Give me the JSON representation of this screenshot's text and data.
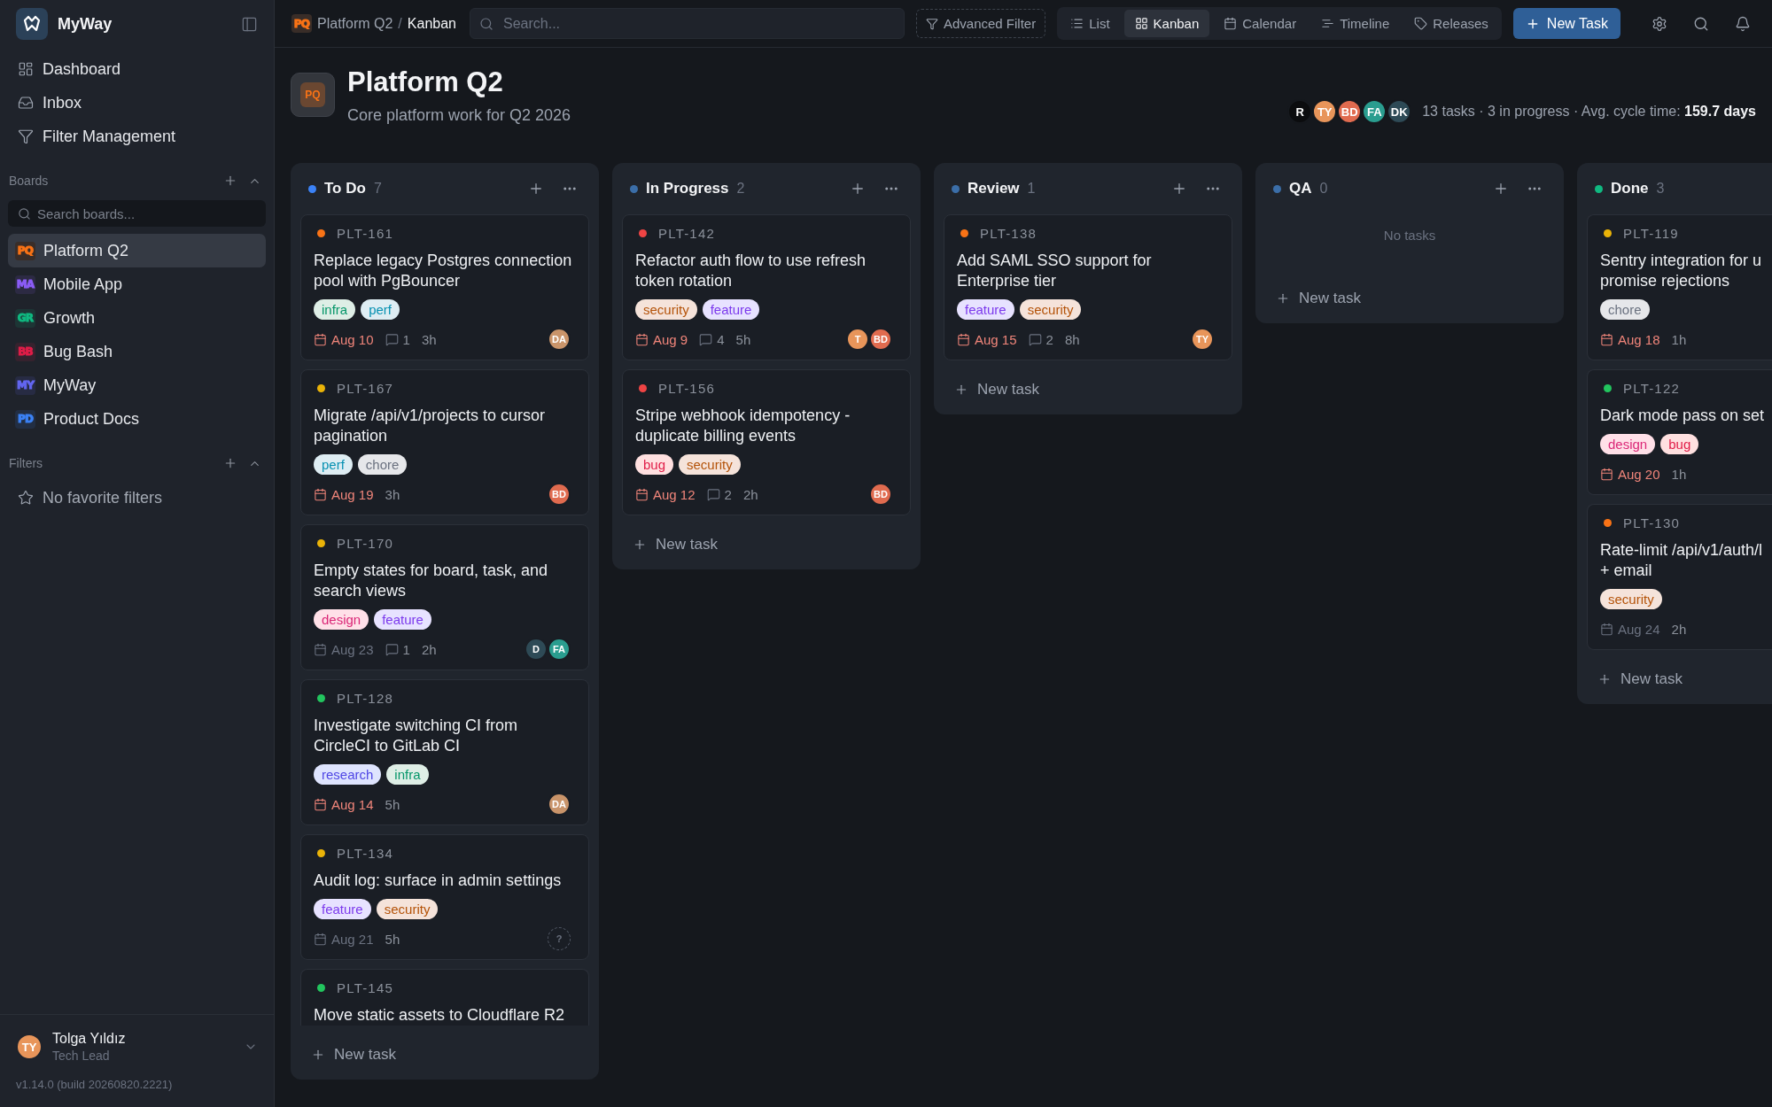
{
  "sidebar": {
    "app_name": "MyWay",
    "nav": [
      {
        "label": "Dashboard"
      },
      {
        "label": "Inbox"
      },
      {
        "label": "Filter Management"
      }
    ],
    "boards": {
      "title": "Boards",
      "expanded": true,
      "search_placeholder": "Search boards...",
      "items": [
        {
          "code": "PQ",
          "label": "Platform Q2",
          "color": "#f97316",
          "selected": true
        },
        {
          "code": "MA",
          "label": "Mobile App",
          "color": "#8b5cf6",
          "selected": false
        },
        {
          "code": "GR",
          "label": "Growth",
          "color": "#10b981",
          "selected": false
        },
        {
          "code": "BB",
          "label": "Bug Bash",
          "color": "#e11d48",
          "selected": false
        },
        {
          "code": "MY",
          "label": "MyWay",
          "color": "#6366f1",
          "selected": false
        },
        {
          "code": "PD",
          "label": "Product Docs",
          "color": "#3b82f6",
          "selected": false
        }
      ]
    },
    "filters": {
      "title": "Filters",
      "expanded": true,
      "empty": "No favorite filters"
    },
    "user": {
      "initials": "TY",
      "name": "Tolga Yıldız",
      "role": "Tech Lead"
    },
    "version": "v1.14.0 (build 20260820.2221)"
  },
  "topbar": {
    "breadcrumb": {
      "code": "PQ",
      "board": "Platform Q2",
      "separator": "/",
      "current": "Kanban"
    },
    "search_placeholder": "Search...",
    "advanced_filter": "Advanced Filter",
    "views": [
      {
        "label": "List",
        "selected": false
      },
      {
        "label": "Kanban",
        "selected": true
      },
      {
        "label": "Calendar",
        "selected": false
      },
      {
        "label": "Timeline",
        "selected": false
      },
      {
        "label": "Releases",
        "selected": false
      }
    ],
    "new_task": "New Task"
  },
  "board": {
    "code": "PQ",
    "title": "Platform Q2",
    "subtitle": "Core platform work for Q2 2026",
    "members": [
      {
        "initials": "R",
        "color": "#0b0c0e"
      },
      {
        "initials": "TY",
        "color": "#e8955a"
      },
      {
        "initials": "BD",
        "color": "#e06b4f"
      },
      {
        "initials": "FA",
        "color": "#2a9d8f"
      },
      {
        "initials": "DK",
        "color": "#2e4a56"
      }
    ],
    "stats": "13 tasks · 3 in progress · Avg. cycle time: **159.7 days**"
  },
  "columns": [
    {
      "title": "To Do",
      "count": "7",
      "color": "#3b82f6",
      "clipped": false,
      "add_label": "New task",
      "cards": [
        {
          "id": "PLT-161",
          "color": "#f97316",
          "title": "Replace legacy Postgres connection pool with PgBouncer",
          "tags": [
            {
              "label": "infra",
              "color": "#059669"
            },
            {
              "label": "perf",
              "color": "#0891b2"
            }
          ],
          "due": {
            "date": "Aug 10",
            "overdue": true
          },
          "comments": "1",
          "estimate": "3h",
          "assignees": [
            {
              "initials": "DA",
              "kind": "person",
              "color": "#c9946a"
            }
          ]
        },
        {
          "id": "PLT-167",
          "color": "#eab308",
          "title": "Migrate /api/v1/projects to cursor pagination",
          "tags": [
            {
              "label": "perf",
              "color": "#0891b2"
            },
            {
              "label": "chore",
              "color": "#6b7280"
            }
          ],
          "due": {
            "date": "Aug 19",
            "overdue": true
          },
          "estimate": "3h",
          "assignees": [
            {
              "initials": "BD",
              "kind": "person",
              "color": "#e06b4f"
            }
          ]
        },
        {
          "id": "PLT-170",
          "color": "#eab308",
          "title": "Empty states for board, task, and search views",
          "tags": [
            {
              "label": "design",
              "color": "#db2777"
            },
            {
              "label": "feature",
              "color": "#7c3aed"
            }
          ],
          "due": {
            "date": "Aug 23",
            "overdue": false
          },
          "comments": "1",
          "estimate": "2h",
          "assignees": [
            {
              "initials": "D",
              "kind": "person",
              "color": "#2e4a56"
            },
            {
              "initials": "FA",
              "kind": "person",
              "color": "#2a9d8f"
            }
          ]
        },
        {
          "id": "PLT-128",
          "color": "#22c55e",
          "title": "Investigate switching CI from CircleCI to GitLab CI",
          "tags": [
            {
              "label": "research",
              "color": "#4f46e5"
            },
            {
              "label": "infra",
              "color": "#059669"
            }
          ],
          "due": {
            "date": "Aug 14",
            "overdue": true
          },
          "estimate": "5h",
          "assignees": [
            {
              "initials": "DA",
              "kind": "person",
              "color": "#c9946a"
            }
          ]
        },
        {
          "id": "PLT-134",
          "color": "#eab308",
          "title": "Audit log: surface in admin settings",
          "tags": [
            {
              "label": "feature",
              "color": "#7c3aed"
            },
            {
              "label": "security",
              "color": "#b45309"
            }
          ],
          "due": {
            "date": "Aug 21",
            "overdue": false
          },
          "estimate": "5h",
          "assignees": [
            {
              "initials": "?",
              "kind": "unassigned"
            }
          ]
        },
        {
          "id": "PLT-145",
          "color": "#22c55e",
          "title": "Move static assets to Cloudflare R2"
        }
      ]
    },
    {
      "title": "In Progress",
      "count": "2",
      "color": "#3b6ea8",
      "clipped": false,
      "add_label": "New task",
      "cards": [
        {
          "id": "PLT-142",
          "color": "#ef4444",
          "title": "Refactor auth flow to use refresh token rotation",
          "tags": [
            {
              "label": "security",
              "color": "#b45309"
            },
            {
              "label": "feature",
              "color": "#7c3aed"
            }
          ],
          "due": {
            "date": "Aug 9",
            "overdue": true
          },
          "comments": "4",
          "estimate": "5h",
          "assignees": [
            {
              "initials": "T",
              "kind": "person",
              "color": "#e8955a"
            },
            {
              "initials": "BD",
              "kind": "person",
              "color": "#e06b4f"
            }
          ]
        },
        {
          "id": "PLT-156",
          "color": "#ef4444",
          "title": "Stripe webhook idempotency - duplicate billing events",
          "tags": [
            {
              "label": "bug",
              "color": "#e11d48"
            },
            {
              "label": "security",
              "color": "#b45309"
            }
          ],
          "due": {
            "date": "Aug 12",
            "overdue": true
          },
          "comments": "2",
          "estimate": "2h",
          "assignees": [
            {
              "initials": "BD",
              "kind": "person",
              "color": "#e06b4f"
            }
          ]
        }
      ]
    },
    {
      "title": "Review",
      "count": "1",
      "color": "#3b6ea8",
      "clipped": false,
      "add_label": "New task",
      "cards": [
        {
          "id": "PLT-138",
          "color": "#f97316",
          "title": "Add SAML SSO support for Enterprise tier",
          "tags": [
            {
              "label": "feature",
              "color": "#7c3aed"
            },
            {
              "label": "security",
              "color": "#b45309"
            }
          ],
          "due": {
            "date": "Aug 15",
            "overdue": true
          },
          "comments": "2",
          "estimate": "8h",
          "assignees": [
            {
              "initials": "TY",
              "kind": "person",
              "color": "#e8955a"
            }
          ]
        }
      ]
    },
    {
      "title": "QA",
      "count": "0",
      "color": "#3b6ea8",
      "clipped": false,
      "add_label": "New task",
      "empty": "No tasks"
    },
    {
      "title": "Done",
      "count": "3",
      "color": "#10b981",
      "clipped": true,
      "add_label": "New task",
      "cards": [
        {
          "id": "PLT-119",
          "color": "#eab308",
          "title": "Sentry integration for u\npromise rejections",
          "tags": [
            {
              "label": "chore",
              "color": "#6b7280"
            }
          ],
          "due": {
            "date": "Aug 18",
            "overdue": true
          },
          "estimate": "1h"
        },
        {
          "id": "PLT-122",
          "color": "#22c55e",
          "title": "Dark mode pass on set",
          "tags": [
            {
              "label": "design",
              "color": "#db2777"
            },
            {
              "label": "bug",
              "color": "#e11d48"
            }
          ],
          "due": {
            "date": "Aug 20",
            "overdue": true
          },
          "estimate": "1h"
        },
        {
          "id": "PLT-130",
          "color": "#f97316",
          "title": "Rate-limit /api/v1/auth/l\n+ email",
          "tags": [
            {
              "label": "security",
              "color": "#b45309"
            }
          ],
          "due": {
            "date": "Aug 24",
            "overdue": false
          },
          "estimate": "2h"
        }
      ]
    }
  ]
}
